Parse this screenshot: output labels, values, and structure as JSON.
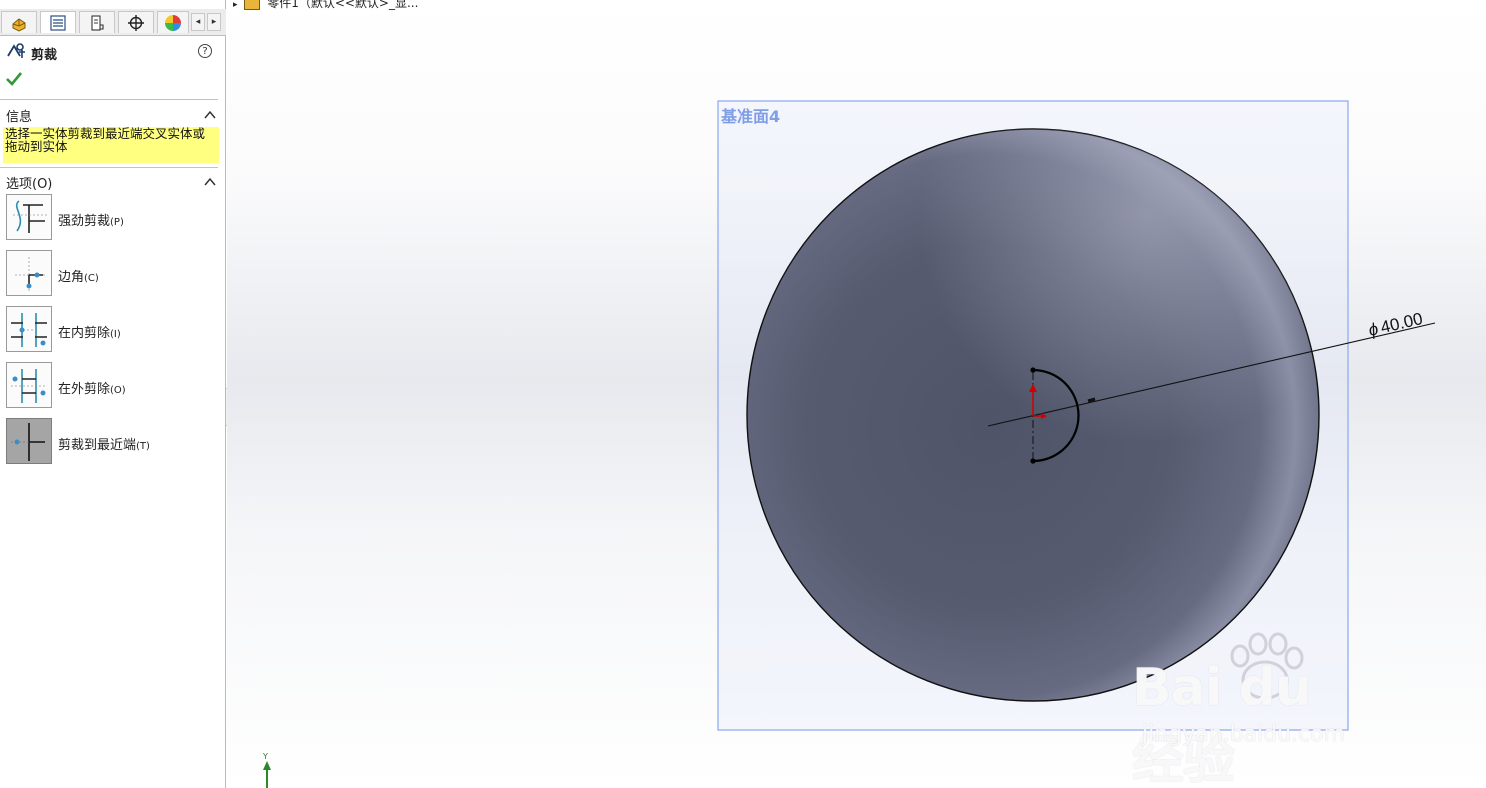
{
  "panel": {
    "title": "剪裁",
    "help": "?",
    "info_section": {
      "title": "信息",
      "text": "选择一实体剪裁到最近端交叉实体或拖动到实体"
    },
    "options_section": {
      "title": "选项(O)",
      "items": [
        {
          "label": "强劲剪裁",
          "key": "(P)",
          "selected": false
        },
        {
          "label": "边角",
          "key": "(C)",
          "selected": false
        },
        {
          "label": "在内剪除",
          "key": "(I)",
          "selected": false
        },
        {
          "label": "在外剪除",
          "key": "(O)",
          "selected": false
        },
        {
          "label": "剪裁到最近端",
          "key": "(T)",
          "selected": true
        }
      ]
    }
  },
  "viewport": {
    "tree_text": "零件1（默认<<默认>_显...",
    "plane_name": "基准面4",
    "dimension": "40.00",
    "dimension_symbol": "ϕ",
    "axis_label": "Y"
  },
  "watermark": {
    "brand": "Bai du 经验",
    "url": "jingyan.baidu.com"
  },
  "colors": {
    "plane_border": "#8aa8ee",
    "plane_label": "#7f9ee7",
    "sphere": "#5a5e72",
    "info_highlight": "#ffff80",
    "origin_red": "#d00000"
  }
}
